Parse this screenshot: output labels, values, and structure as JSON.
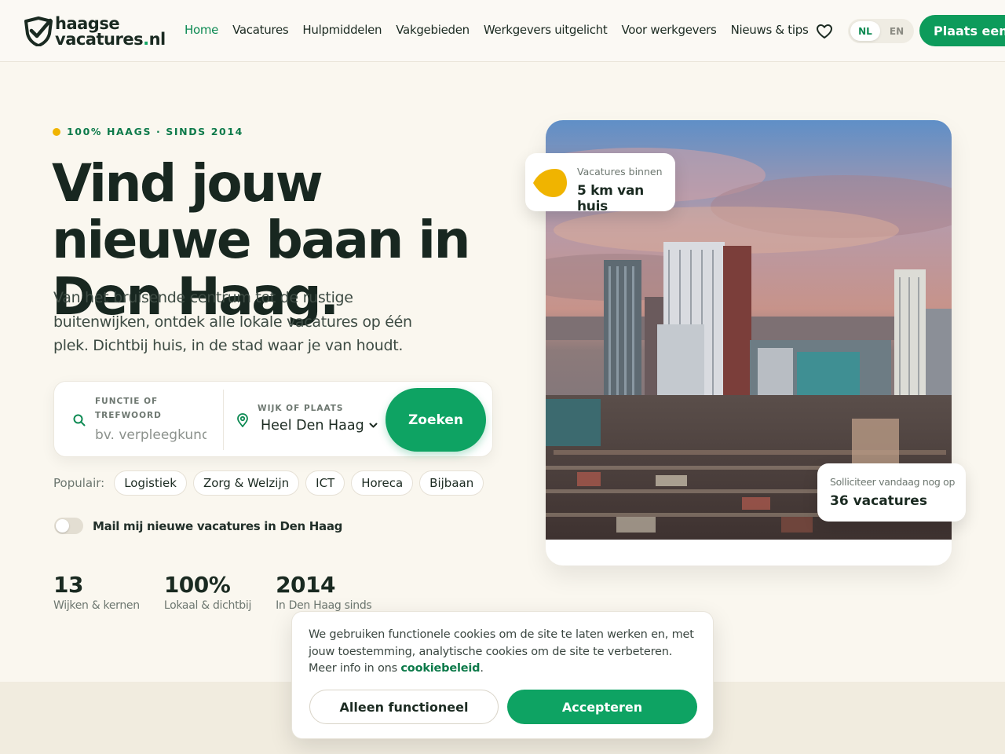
{
  "brand": {
    "line1": "haagse",
    "line2": "vacatures",
    "dot": ".",
    "tld": "nl",
    "accent": "#0d9b5b",
    "highlight": "#f0b400"
  },
  "nav": {
    "items": [
      "Home",
      "Vacatures",
      "Hulpmiddelen",
      "Vakgebieden",
      "Werkgevers uitgelicht",
      "Voor werkgevers",
      "Nieuws & tips"
    ],
    "active": "Home",
    "favorites_icon": "heart-icon",
    "lang_nl": "NL",
    "lang_en": "EN",
    "cta": "Plaats een vacature"
  },
  "hero": {
    "eyebrow": "100% HAAGS · SINDS 2014",
    "title": "Vind jouw nieuwe baan in Den Haag.",
    "subtitle": "Van het bruisende centrum tot de rustige buitenwijken, ontdek alle lokale vacatures op één plek. Dichtbij huis, in de stad waar je van houdt."
  },
  "search": {
    "field1_label": "FUNCTIE OF TREFWOORD",
    "field1_placeholder": "bv. verpleegkundige",
    "field1_icon": "search-icon",
    "field2_label": "WIJK OF PLAATS",
    "field2_value": "Heel Den Haag",
    "field2_icon": "map-pin-icon",
    "button": "Zoeken"
  },
  "popular": {
    "label": "Populair:",
    "chips": [
      "Logistiek",
      "Zorg & Welzijn",
      "ICT",
      "Horeca",
      "Bijbaan"
    ]
  },
  "alert_toggle": {
    "label": "Mail mij nieuwe vacatures in Den Haag",
    "on": false
  },
  "stats": [
    {
      "value": "13",
      "label": "Wijken & kernen"
    },
    {
      "value": "100%",
      "label": "Lokaal & dichtbij"
    },
    {
      "value": "2014",
      "label": "In Den Haag sinds"
    }
  ],
  "badges": {
    "top_small": "Vacatures binnen",
    "top_big": "5 km van huis",
    "bottom_small": "Solliciteer vandaag nog op",
    "bottom_big": "36 vacatures"
  },
  "cookie": {
    "text": "We gebruiken functionele cookies om de site te laten werken en, met jouw toestemming, analytische cookies om de site te verbeteren. Meer info in ons",
    "link": "cookiebeleid",
    "period": ".",
    "decline": "Alleen functioneel",
    "accept": "Accepteren"
  }
}
